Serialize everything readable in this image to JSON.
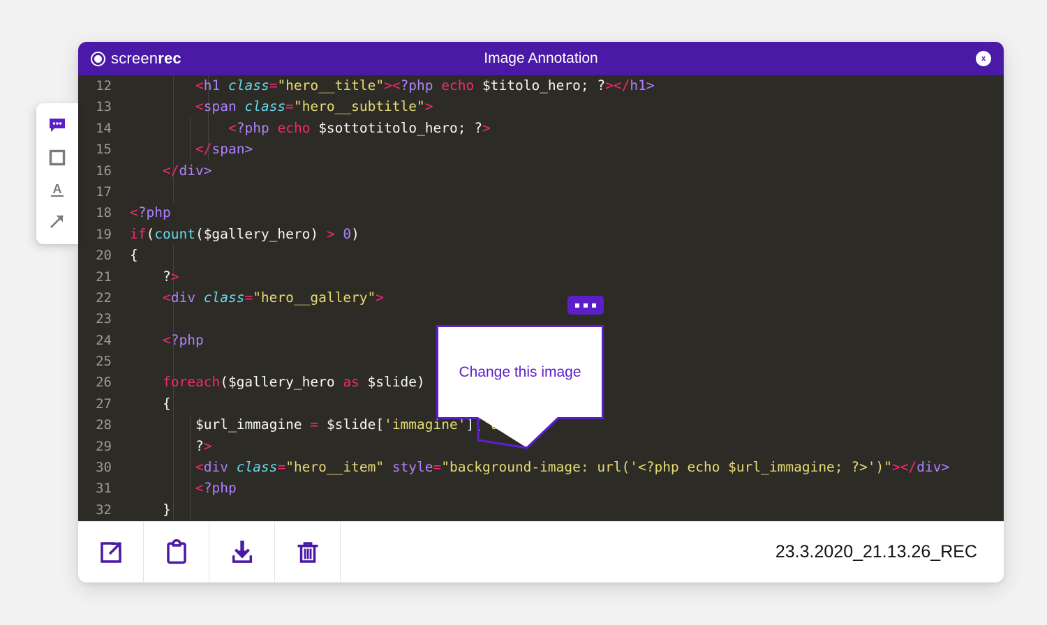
{
  "brand": {
    "logo_icon": "record-circle-icon",
    "name_light": "screen",
    "name_bold": "rec"
  },
  "window": {
    "title": "Image Annotation",
    "close_label": "x",
    "close_icon": "close-icon"
  },
  "theme": {
    "header_purple": "#4a19a6",
    "accent_purple": "#5b1fc7",
    "canvas_bg": "#2d2b26",
    "page_bg": "#f2f2f2",
    "icon_purple": "#4a19a6",
    "tool_inactive": "#7b7b7b"
  },
  "tool_palette": {
    "tools": [
      {
        "name": "speech-bubble-tool",
        "icon": "speech-bubble-icon",
        "active": true
      },
      {
        "name": "rectangle-tool",
        "icon": "square-icon",
        "active": false
      },
      {
        "name": "text-tool",
        "icon": "text-a-icon",
        "active": false
      },
      {
        "name": "arrow-tool",
        "icon": "arrow-up-right-icon",
        "active": false
      }
    ]
  },
  "annotation": {
    "callout_text": "Change this image",
    "menu_icon": "ellipsis-icon",
    "menu_label": "..."
  },
  "action_bar": {
    "buttons": [
      {
        "name": "share-button",
        "icon": "share-external-link-icon"
      },
      {
        "name": "copy-to-clipboard-button",
        "icon": "clipboard-icon"
      },
      {
        "name": "download-button",
        "icon": "download-icon"
      },
      {
        "name": "delete-button",
        "icon": "trash-icon"
      }
    ],
    "file_name": "23.3.2020_21.13.26_REC"
  },
  "code": {
    "language": "php-html",
    "first_line_number": 12,
    "lines": [
      {
        "n": "12",
        "raw": "        <h1 class=\"hero__title\"><?php echo $titolo_hero; ?></h1>"
      },
      {
        "n": "13",
        "raw": "        <span class=\"hero__subtitle\">"
      },
      {
        "n": "14",
        "raw": "            <?php echo $sottotitolo_hero; ?>"
      },
      {
        "n": "15",
        "raw": "        </span>"
      },
      {
        "n": "16",
        "raw": "    </div>"
      },
      {
        "n": "17",
        "raw": ""
      },
      {
        "n": "18",
        "raw": "<?php"
      },
      {
        "n": "19",
        "raw": "if(count($gallery_hero) > 0)"
      },
      {
        "n": "20",
        "raw": "{"
      },
      {
        "n": "21",
        "raw": "    ?>"
      },
      {
        "n": "22",
        "raw": "    <div class=\"hero__gallery\">"
      },
      {
        "n": "23",
        "raw": ""
      },
      {
        "n": "24",
        "raw": "    <?php"
      },
      {
        "n": "25",
        "raw": ""
      },
      {
        "n": "26",
        "raw": "    foreach($gallery_hero as $slide)"
      },
      {
        "n": "27",
        "raw": "    {"
      },
      {
        "n": "28",
        "raw": "        $url_immagine = $slide['immagine']['url'];"
      },
      {
        "n": "29",
        "raw": "        ?>"
      },
      {
        "n": "30",
        "raw": "        <div class=\"hero__item\" style=\"background-image: url('<?php echo $url_immagine; ?>')\"></div>"
      },
      {
        "n": "31",
        "raw": "        <?php"
      },
      {
        "n": "32",
        "raw": "    }"
      }
    ]
  }
}
